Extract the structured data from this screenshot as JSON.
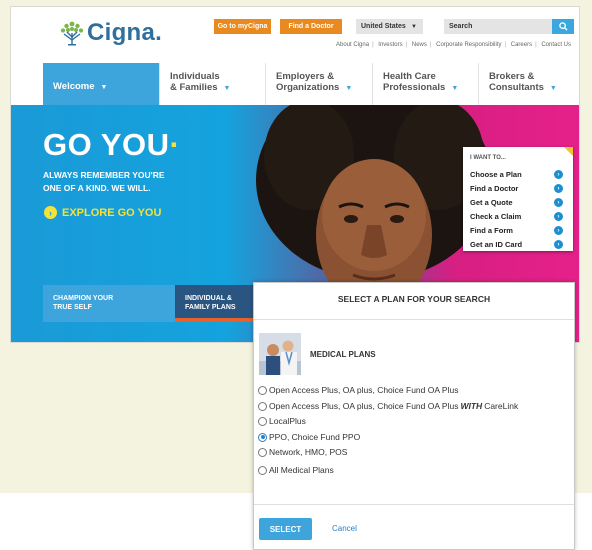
{
  "colors": {
    "brand_blue": "#3ea4dc",
    "orange": "#e88a1f",
    "magenta": "#e6208a",
    "yellow": "#f4e23a",
    "navy": "#2a5580"
  },
  "header": {
    "logo_text": "Cigna.",
    "my_cigna_label": "Go to myCigna",
    "find_doctor_label": "Find a Doctor",
    "country_value": "United States",
    "search_placeholder": "Search",
    "utility_links": [
      "About Cigna",
      "Investors",
      "News",
      "Corporate Responsibility",
      "Careers",
      "Contact Us"
    ]
  },
  "nav": [
    {
      "line1": "Welcome",
      "line2": ""
    },
    {
      "line1": "Individuals",
      "line2": "& Families"
    },
    {
      "line1": "Employers &",
      "line2": "Organizations"
    },
    {
      "line1": "Health Care",
      "line2": "Professionals"
    },
    {
      "line1": "Brokers &",
      "line2": "Consultants"
    }
  ],
  "hero": {
    "headline": "GO YOU",
    "subline1": "ALWAYS REMEMBER YOU'RE",
    "subline2": "ONE OF A KIND. WE WILL.",
    "explore_label": "EXPLORE GO YOU",
    "tile1_line1": "CHAMPION YOUR",
    "tile1_line2": "TRUE SELF",
    "tile2_line1": "INDIVIDUAL &",
    "tile2_line2": "FAMILY PLANS"
  },
  "i_want": {
    "title": "I WANT TO...",
    "items": [
      "Choose a Plan",
      "Find a Doctor",
      "Get a Quote",
      "Check a Claim",
      "Find a Form",
      "Get an ID Card"
    ]
  },
  "modal": {
    "title": "SELECT A PLAN FOR YOUR SEARCH",
    "section_heading": "MEDICAL PLANS",
    "options": [
      {
        "label": "Open Access Plus, OA plus, Choice Fund OA Plus",
        "selected": false
      },
      {
        "label": "Open Access Plus, OA plus, Choice Fund OA Plus",
        "emph": "WITH",
        "suffix": "CareLink",
        "selected": false
      },
      {
        "label": "LocalPlus",
        "selected": false
      },
      {
        "label": "PPO, Choice Fund PPO",
        "selected": true
      },
      {
        "label": "Network, HMO, POS",
        "selected": false
      },
      {
        "label": "All Medical Plans",
        "selected": false
      }
    ],
    "select_label": "SELECT",
    "cancel_label": "Cancel"
  }
}
